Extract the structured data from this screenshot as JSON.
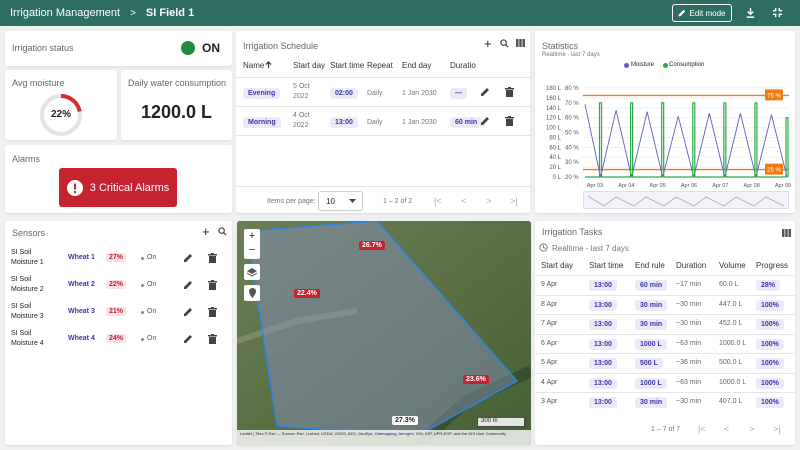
{
  "header": {
    "app_title": "Irrigation Management",
    "separator": ">",
    "field_name": "SI Field 1",
    "edit_label": "Edit mode"
  },
  "status": {
    "title": "Irrigation status",
    "value": "ON",
    "color": "#1e8a3a"
  },
  "moisture": {
    "title": "Avg moisture",
    "value": "22%",
    "level": 0.22
  },
  "consumption": {
    "title": "Daily water consumption",
    "value": "1200.0 L"
  },
  "alarms": {
    "title": "Alarms",
    "button_label": "3 Critical Alarms",
    "color": "#c62331"
  },
  "schedule": {
    "title": "Irrigation Schedule",
    "columns": [
      "Name",
      "Start day",
      "Start time",
      "Repeat",
      "End day",
      "Duratio"
    ],
    "sort_icon": "arrow-up-icon",
    "rows": [
      {
        "name": "Evening",
        "start_day": "5 Oct 2022",
        "start_time": "02:00",
        "repeat": "Daily",
        "end_day": "1 Jan 2030",
        "duration": "—"
      },
      {
        "name": "Morning",
        "start_day": "4 Oct 2022",
        "start_time": "13:00",
        "repeat": "Daily",
        "end_day": "1 Jan 2030",
        "duration": "60 min"
      }
    ],
    "items_per_page_label": "Items per page:",
    "items_per_page": "10",
    "range": "1 – 2 of 2"
  },
  "statistics": {
    "title": "Statistics",
    "subtitle": "Realtime - last 7 days",
    "legend": [
      "Moisture",
      "Consumption"
    ],
    "badge_top": "75 %",
    "badge_bottom": "25 %",
    "left_ticks": [
      "180 L",
      "160 L",
      "140 L",
      "120 L",
      "100 L",
      "80 L",
      "60 L",
      "40 L",
      "20 L",
      "0 L"
    ],
    "right_ticks": [
      "80 %",
      "70 %",
      "60 %",
      "50 %",
      "40 %",
      "30 %",
      "20 %"
    ],
    "x_ticks": [
      "Apr 03",
      "Apr 04",
      "Apr 05",
      "Apr 06",
      "Apr 07",
      "Apr 08",
      "Apr 09"
    ]
  },
  "chart_data": {
    "type": "line",
    "x": [
      "Apr 03",
      "Apr 04",
      "Apr 05",
      "Apr 06",
      "Apr 07",
      "Apr 08",
      "Apr 09"
    ],
    "series": [
      {
        "name": "Moisture",
        "values": [
          69,
          20,
          65,
          20,
          64,
          20,
          61,
          20,
          63,
          20,
          63,
          20,
          62,
          20
        ],
        "color": "#5b5fc7"
      },
      {
        "name": "Consumption",
        "values": [
          0,
          150,
          0,
          150,
          0,
          150,
          0,
          150,
          0,
          150,
          0,
          150,
          0,
          120
        ],
        "color": "#2ea84a"
      }
    ],
    "thresholds": [
      {
        "label": "75 %",
        "value": 75,
        "color": "#f07b16"
      },
      {
        "label": "25 %",
        "value": 25,
        "color": "#f07b16"
      }
    ],
    "ylim_left": [
      0,
      180
    ],
    "ylim_right": [
      20,
      80
    ]
  },
  "sensors": {
    "title": "Sensors",
    "rows": [
      {
        "name": "SI Soil Moisture 1",
        "crop": "Wheat 1",
        "value": "27%",
        "state": "On"
      },
      {
        "name": "SI Soil Moisture 2",
        "crop": "Wheat 2",
        "value": "22%",
        "state": "On"
      },
      {
        "name": "SI Soil Moisture 3",
        "crop": "Wheat 3",
        "value": "21%",
        "state": "On"
      },
      {
        "name": "SI Soil Moisture 4",
        "crop": "Wheat 4",
        "value": "24%",
        "state": "On"
      }
    ]
  },
  "map": {
    "zoom_in": "+",
    "zoom_out": "−",
    "labels": [
      "26.7%",
      "22.4%",
      "23.6%",
      "27.3%"
    ],
    "scale": "300 m",
    "attribution": "Leaflet | Tiles © Esri — Source: Esri, i-cubed, USDA, USGS, AEX, GeoEye, Getmapping, Aerogrid, IGN, IGP, UPR-EGP, and the GIS User Community"
  },
  "tasks": {
    "title": "Irrigation Tasks",
    "subtitle": "Realtime - last 7 days",
    "columns": [
      "Start day",
      "Start time",
      "End rule",
      "Duration",
      "Volume",
      "Progress"
    ],
    "rows": [
      {
        "day": "9 Apr",
        "time": "13:00",
        "rule": "60 min",
        "duration": "~17 min",
        "volume": "60.0 L",
        "progress": "28%"
      },
      {
        "day": "8 Apr",
        "time": "13:00",
        "rule": "30 min",
        "duration": "~30 min",
        "volume": "447.0 L",
        "progress": "100%"
      },
      {
        "day": "7 Apr",
        "time": "13:00",
        "rule": "30 min",
        "duration": "~30 min",
        "volume": "452.0 L",
        "progress": "100%"
      },
      {
        "day": "6 Apr",
        "time": "13:00",
        "rule": "1000 L",
        "duration": "~63 min",
        "volume": "1000.0 L",
        "progress": "100%"
      },
      {
        "day": "5 Apr",
        "time": "13:00",
        "rule": "500 L",
        "duration": "~36 min",
        "volume": "500.0 L",
        "progress": "100%"
      },
      {
        "day": "4 Apr",
        "time": "13:00",
        "rule": "1000 L",
        "duration": "~63 min",
        "volume": "1000.0 L",
        "progress": "100%"
      },
      {
        "day": "3 Apr",
        "time": "13:00",
        "rule": "30 min",
        "duration": "~30 min",
        "volume": "407.0 L",
        "progress": "100%"
      }
    ],
    "range": "1 – 7 of 7"
  }
}
